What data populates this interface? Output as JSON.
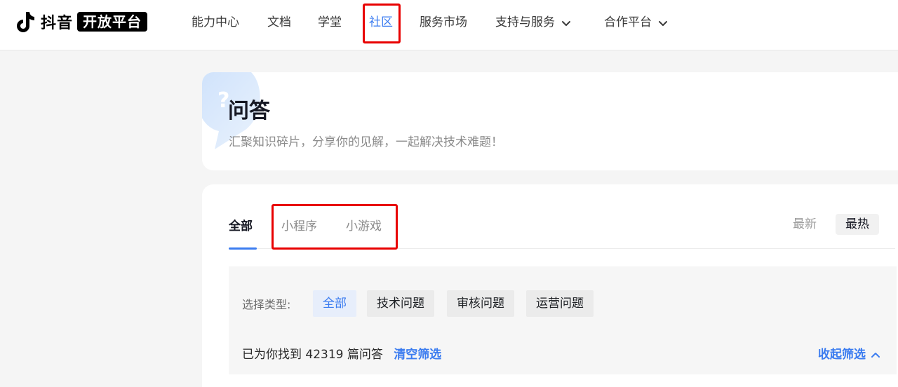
{
  "header": {
    "logo_text": "抖音",
    "logo_badge": "开放平台",
    "nav": [
      {
        "label": "能力中心"
      },
      {
        "label": "文档"
      },
      {
        "label": "学堂"
      },
      {
        "label": "社区",
        "active": true
      },
      {
        "label": "服务市场"
      },
      {
        "label": "支持与服务",
        "dropdown": true
      },
      {
        "label": "合作平台",
        "dropdown": true
      }
    ]
  },
  "hero": {
    "title": "问答",
    "subtitle": "汇聚知识碎片，分享你的见解，一起解决技术难题！"
  },
  "tabs": [
    {
      "label": "全部",
      "active": true
    },
    {
      "label": "小程序"
    },
    {
      "label": "小游戏"
    }
  ],
  "sort": {
    "latest": "最新",
    "hot": "最热",
    "selected": "最热"
  },
  "filter": {
    "label": "选择类型:",
    "types": [
      {
        "label": "全部",
        "active": true
      },
      {
        "label": "技术问题"
      },
      {
        "label": "审核问题"
      },
      {
        "label": "运营问题"
      }
    ]
  },
  "result": {
    "prefix": "已为你找到",
    "count": "42319",
    "suffix": "篇问答",
    "clear": "清空筛选",
    "collapse": "收起筛选"
  },
  "colors": {
    "accent": "#3b7cf0",
    "highlight_box": "#e80000"
  }
}
